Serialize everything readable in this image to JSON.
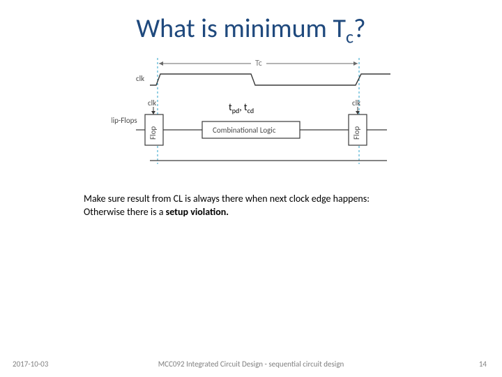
{
  "title": {
    "pre": "What is minimum T",
    "sub": "c",
    "post": "?"
  },
  "diagram": {
    "tc_label": "Tc",
    "clk1": "clk",
    "flipflops": "Flip-Flops",
    "clk2": "clk",
    "clk3": "clk",
    "flop1": "Flop",
    "flop2": "Flop",
    "comb": "Combinational Logic"
  },
  "overlay": {
    "t": "t",
    "pd": "pd",
    "comma": ", ",
    "t2": "t",
    "cd": "cd"
  },
  "body": {
    "line1": "Make sure result from CL is always there when next clock edge happens:",
    "line2a": "Otherwise there is a ",
    "line2b": "setup violation."
  },
  "footer": {
    "date": "2017-10-03",
    "course": "MCC092 Integrated Circuit Design - sequential circuit design",
    "page": "14"
  }
}
